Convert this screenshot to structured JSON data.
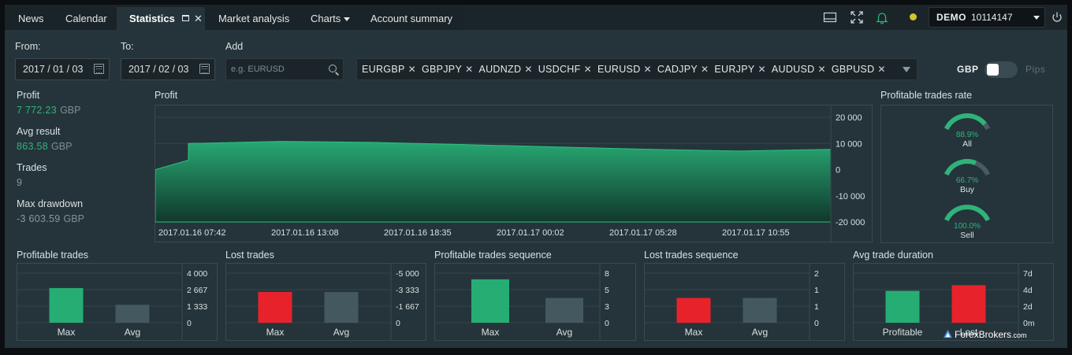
{
  "tabs": [
    {
      "label": "News"
    },
    {
      "label": "Calendar"
    },
    {
      "label": "Statistics"
    },
    {
      "label": "Market analysis"
    },
    {
      "label": "Charts"
    },
    {
      "label": "Account summary"
    }
  ],
  "account": {
    "mode": "DEMO",
    "number": "10114147"
  },
  "filters": {
    "from_label": "From:",
    "from_value": "2017 / 01 / 03",
    "to_label": "To:",
    "to_value": "2017 / 02 / 03",
    "add_label": "Add",
    "add_placeholder": "e.g. EURUSD",
    "symbols": [
      "EURGBP",
      "GBPJPY",
      "AUDNZD",
      "USDCHF",
      "EURUSD",
      "CADJPY",
      "EURJPY",
      "AUDUSD",
      "GBPUSD"
    ],
    "currency_label": "GBP",
    "pips_label": "Pips",
    "pips_enabled": false
  },
  "stats": {
    "profit_label": "Profit",
    "profit_value": "7 772.23",
    "profit_unit": "GBP",
    "avg_label": "Avg result",
    "avg_value": "863.58",
    "avg_unit": "GBP",
    "trades_label": "Trades",
    "trades_value": "9",
    "drawdown_label": "Max drawdown",
    "drawdown_value": "-3 603.59",
    "drawdown_unit": "GBP"
  },
  "colors": {
    "profit": "#26ad74",
    "loss": "#e8222b",
    "neutral": "#445860",
    "accent": "#2fb37a"
  },
  "profit_chart": {
    "title": "Profit",
    "y_ticks": [
      "20 000",
      "10 000",
      "0",
      "-10 000",
      "-20 000"
    ],
    "x_ticks": [
      "2017.01.16 07:42",
      "2017.01.16 13:08",
      "2017.01.16 18:35",
      "2017.01.17 00:02",
      "2017.01.17 05:28",
      "2017.01.17 10:55"
    ]
  },
  "rates": {
    "title": "Profitable trades rate",
    "gauges": [
      {
        "label": "All",
        "value_text": "88.9%",
        "value": 0.889
      },
      {
        "label": "Buy",
        "value_text": "66.7%",
        "value": 0.667
      },
      {
        "label": "Sell",
        "value_text": "100.0%",
        "value": 1.0
      }
    ]
  },
  "chart_data": [
    {
      "type": "area",
      "title": "Profit",
      "x_labels": [
        "2017.01.16 07:42",
        "2017.01.16 13:08",
        "2017.01.16 18:35",
        "2017.01.17 00:02",
        "2017.01.17 05:28",
        "2017.01.17 10:55"
      ],
      "series": [
        {
          "values": [
            0,
            10000,
            3600,
            10800,
            10400,
            9600,
            8700,
            7800,
            7100,
            7772
          ]
        }
      ],
      "ylim": [
        -20000,
        20000
      ]
    },
    {
      "type": "bar",
      "title": "Profitable trades",
      "categories": [
        "Max",
        "Avg"
      ],
      "values": [
        2800,
        1450
      ],
      "y_ticks": [
        "4 000",
        "2 667",
        "1 333",
        "0"
      ],
      "ylim": [
        0,
        4000
      ],
      "bar_colors": [
        "#26ad74",
        "#445860"
      ]
    },
    {
      "type": "bar",
      "title": "Lost trades",
      "categories": [
        "Max",
        "Avg"
      ],
      "values": [
        -3100,
        -3100
      ],
      "y_ticks": [
        "-5 000",
        "-3 333",
        "-1 667",
        "0"
      ],
      "ylim": [
        0,
        -5000
      ],
      "bar_colors": [
        "#e8222b",
        "#445860"
      ]
    },
    {
      "type": "bar",
      "title": "Profitable trades sequence",
      "categories": [
        "Max",
        "Avg"
      ],
      "values": [
        7,
        4
      ],
      "y_ticks": [
        "8",
        "5",
        "3",
        "0"
      ],
      "ylim": [
        0,
        8
      ],
      "bar_colors": [
        "#26ad74",
        "#445860"
      ]
    },
    {
      "type": "bar",
      "title": "Lost trades sequence",
      "categories": [
        "Max",
        "Avg"
      ],
      "values": [
        1,
        1
      ],
      "y_ticks": [
        "2",
        "1",
        "1",
        "0"
      ],
      "ylim": [
        0,
        2
      ],
      "bar_colors": [
        "#e8222b",
        "#445860"
      ]
    },
    {
      "type": "bar",
      "title": "Avg trade duration",
      "categories": [
        "Profitable",
        "Lost"
      ],
      "values": [
        4.5,
        5.3
      ],
      "y_ticks": [
        "7d",
        "4d",
        "2d",
        "0m"
      ],
      "ylim": [
        0,
        7
      ],
      "bar_colors": [
        "#26ad74",
        "#e8222b"
      ]
    }
  ],
  "watermark": {
    "brand": "ForexBrokers",
    "tld": ".com"
  }
}
